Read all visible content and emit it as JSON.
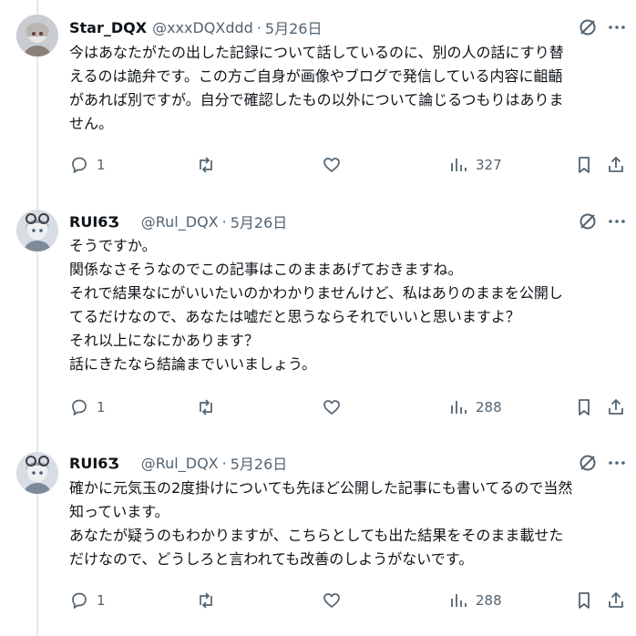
{
  "tweets": [
    {
      "name": "Star_DQX",
      "handle": "@xxxDQXddd",
      "sep": "·",
      "date": "5月26日",
      "lines": [
        "今はあなたがたの出した記録について話しているのに、別の人の話にすり替",
        "えるのは詭弁です。この方ご自身が画像やブログで発信している内容に齟齬",
        "があれば別ですが。自分で確認したもの以外について論じるつもりはありま",
        "せん。"
      ],
      "replies": "1",
      "views": "327"
    },
    {
      "name": "RUI6Ʒ",
      "handle": "@Rul_DQX",
      "sep": "·",
      "date": "5月26日",
      "lines": [
        "そうですか。",
        "関係なさそうなのでこの記事はこのままあげておきますね。",
        "それで結果なにがいいたいのかわかりませんけど、私はありのままを公開し",
        "てるだけなので、あなたは嘘だと思うならそれでいいと思いますよ？",
        "それ以上になにかあります？",
        "話にきたなら結論までいいましょう。"
      ],
      "replies": "1",
      "views": "288"
    },
    {
      "name": "RUI6Ʒ",
      "handle": "@Rul_DQX",
      "sep": "·",
      "date": "5月26日",
      "lines": [
        "確かに元気玉の2度掛けについても先ほど公開した記事にも書いてるので当然",
        "知っています。",
        "あなたが疑うのもわかりますが、こちらとしても出た結果をそのまま載せた",
        "だけなので、どうしろと言われても改善のしようがないです。"
      ],
      "replies": "1",
      "views": "288"
    }
  ],
  "icons": {
    "reply": "reply-icon",
    "retweet": "retweet-icon",
    "like": "like-icon",
    "views": "views-icon",
    "bookmark": "bookmark-icon",
    "share": "share-icon",
    "grok": "grok-icon",
    "more": "more-icon"
  },
  "colors": {
    "text": "#0f1419",
    "secondary": "#536471",
    "divider": "#e6e8ea"
  }
}
